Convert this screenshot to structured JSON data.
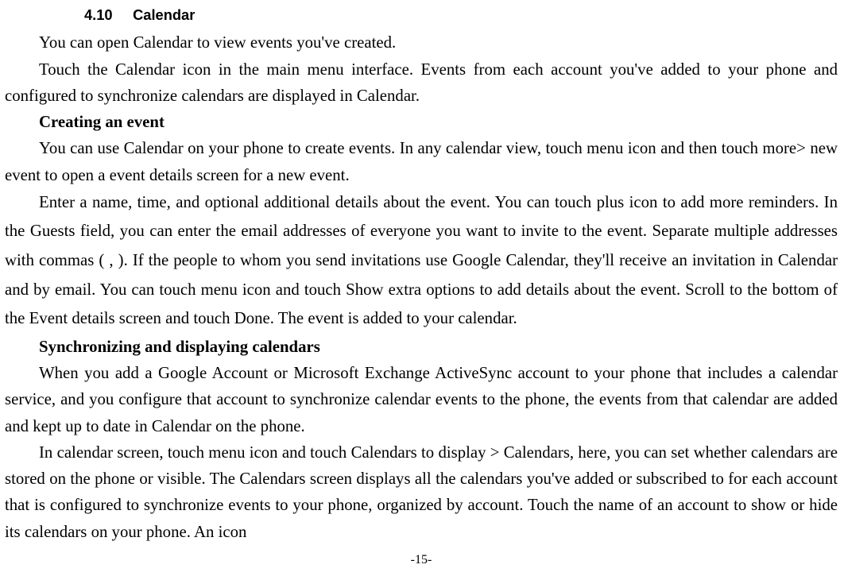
{
  "section": {
    "number": "4.10",
    "title": "Calendar"
  },
  "p1": "You can open Calendar to view events you've created.",
  "p2": "Touch the Calendar icon in the main menu interface. Events from each account you've added to your phone and configured to synchronize calendars are displayed in Calendar.",
  "h1": "Creating an event",
  "p3": "You can use Calendar on your phone to create events. In any calendar view, touch menu icon and then touch more> new event to open a event details screen for a new event.",
  "p4": "Enter a name, time, and optional additional details about the event. You can touch plus icon to add more reminders. In the Guests field, you can enter the email addresses of everyone you want to invite to the event. Separate multiple addresses with commas ( , ). If the people to whom you send invitations use Google Calendar, they'll receive an invitation in Calendar and by email. You can touch menu icon and touch Show extra options to add details about the event. Scroll to the bottom of the Event details screen and touch Done. The event is added to your calendar.",
  "h2": "Synchronizing and displaying calendars",
  "p5": "When you add a Google Account or Microsoft Exchange ActiveSync account to your phone that includes a calendar service, and you configure that account to synchronize calendar events to the phone, the events from that calendar are added and kept up to date in Calendar on the phone.",
  "p6": "In calendar screen, touch menu icon and touch Calendars to display > Calendars, here, you can set whether calendars are stored on the phone or visible. The Calendars screen displays all the calendars you've added or subscribed to for each account that is configured to synchronize events to your phone, organized by account. Touch the name of an account to show or hide its calendars on your phone. An icon",
  "pageNumber": "-15-"
}
